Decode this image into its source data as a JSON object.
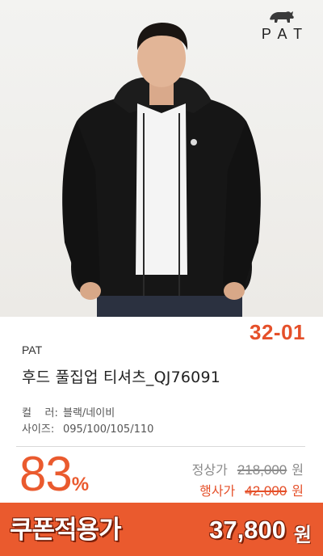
{
  "logo": {
    "icon": "rhino-icon",
    "text": "PAT"
  },
  "product": {
    "code": "32-01",
    "brand": "PAT",
    "name": "후드 풀집업 티셔츠_QJ76091",
    "specs": [
      {
        "key": "컬    러:",
        "value": "블랙/네이비"
      },
      {
        "key": "사이즈:",
        "value": "095/100/105/110"
      }
    ]
  },
  "pricing": {
    "discount_number": "83",
    "discount_symbol": "%",
    "regular_label": "정상가",
    "regular_price": "218,000",
    "sale_label": "행사가",
    "sale_price": "42,000",
    "unit": "원"
  },
  "coupon": {
    "label": "쿠폰적용가",
    "price": "37,800",
    "unit": "원"
  },
  "colors": {
    "accent": "#ea5a2e",
    "jacket": "#151515",
    "tee": "#f4f4f4"
  }
}
